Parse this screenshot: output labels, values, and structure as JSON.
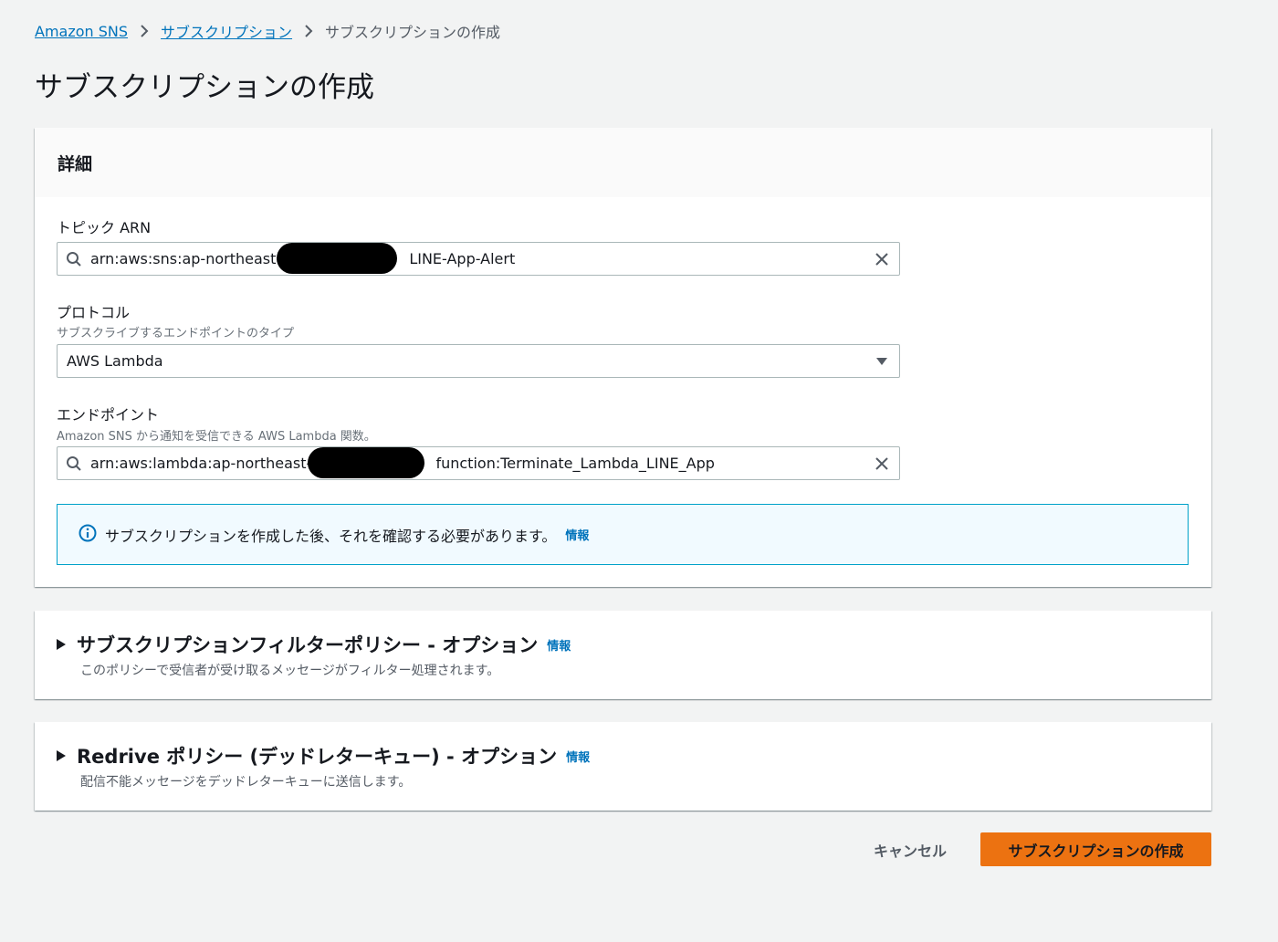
{
  "breadcrumb": {
    "root": "Amazon SNS",
    "parent": "サブスクリプション",
    "current": "サブスクリプションの作成"
  },
  "page_title": "サブスクリプションの作成",
  "details": {
    "header": "詳細",
    "topic_arn": {
      "label": "トピック ARN",
      "value_prefix": "arn:aws:sns:ap-northeast-1",
      "value_suffix": "LINE-App-Alert"
    },
    "protocol": {
      "label": "プロトコル",
      "description": "サブスクライブするエンドポイントのタイプ",
      "selected": "AWS Lambda"
    },
    "endpoint": {
      "label": "エンドポイント",
      "description": "Amazon SNS から通知を受信できる AWS Lambda 関数。",
      "value_prefix": "arn:aws:lambda:ap-northeast-1",
      "value_suffix": "function:Terminate_Lambda_LINE_App"
    },
    "info_alert": {
      "message": "サブスクリプションを作成した後、それを確認する必要があります。",
      "link": "情報"
    }
  },
  "filter_policy": {
    "title": "サブスクリプションフィルターポリシー - オプション",
    "info": "情報",
    "description": "このポリシーで受信者が受け取るメッセージがフィルター処理されます。"
  },
  "redrive_policy": {
    "title": "Redrive ポリシー (デッドレターキュー) - オプション",
    "info": "情報",
    "description": "配信不能メッセージをデッドレターキューに送信します。"
  },
  "actions": {
    "cancel": "キャンセル",
    "create": "サブスクリプションの作成"
  },
  "colors": {
    "link": "#0073bb",
    "primary_button": "#ec7211",
    "alert_border": "#00a1c9",
    "alert_bg": "#f1faff"
  },
  "icons": [
    "search-icon",
    "clear-icon",
    "caret-down-icon",
    "info-icon",
    "expand-triangle-icon",
    "chevron-right-icon"
  ]
}
